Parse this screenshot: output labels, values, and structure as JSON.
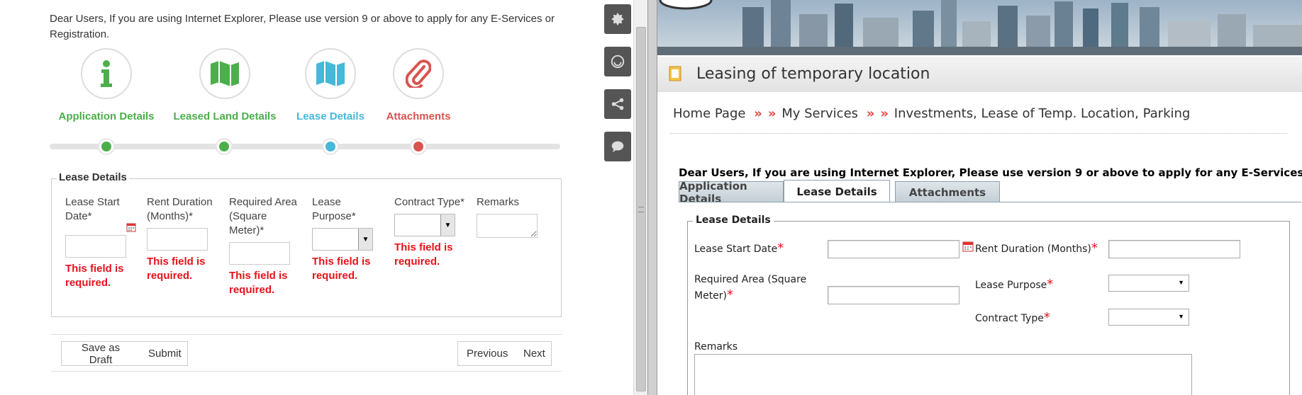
{
  "left": {
    "notice": "Dear Users, If you are using Internet Explorer, Please use version 9 or above to apply for any E-Services or Registration.",
    "steps": [
      {
        "label": "Application Details",
        "color": "#4cae4c",
        "icon": "info-icon"
      },
      {
        "label": "Leased Land Details",
        "color": "#4cae4c",
        "icon": "map-icon"
      },
      {
        "label": "Lease Details",
        "color": "#46b8da",
        "icon": "map-icon"
      },
      {
        "label": "Attachments",
        "color": "#d9534f",
        "icon": "paperclip-icon"
      }
    ],
    "legend": "Lease Details",
    "fields": {
      "lease_start": {
        "label": "Lease Start Date*",
        "value": ""
      },
      "rent_duration": {
        "label": "Rent Duration (Months)*",
        "value": ""
      },
      "required_area": {
        "label": "Required Area (Square Meter)*",
        "value": ""
      },
      "lease_purpose": {
        "label": "Lease Purpose*",
        "value": ""
      },
      "contract_type": {
        "label": "Contract Type*",
        "value": ""
      },
      "remarks": {
        "label": "Remarks",
        "value": ""
      }
    },
    "error": "This field is required.",
    "buttons": {
      "save_draft": "Save as Draft",
      "submit": "Submit",
      "previous": "Previous",
      "next": "Next"
    }
  },
  "toolbar": {
    "icons": [
      "gear-icon",
      "smiley-icon",
      "share-icon",
      "chat-icon"
    ]
  },
  "right": {
    "title": "Leasing of temporary location",
    "breadcrumb": [
      "Home Page",
      "My Services",
      "Investments, Lease of Temp. Location, Parking"
    ],
    "breadcrumb_sep": "»",
    "notice": "Dear Users, If you are using Internet Explorer, Please use version 9 or above to apply for any E-Services or Registration.",
    "tabs": [
      {
        "label": "Application Details",
        "active": false
      },
      {
        "label": "Lease Details",
        "active": true
      },
      {
        "label": "Attachments",
        "active": false
      }
    ],
    "legend": "Lease Details",
    "fields": {
      "lease_start": "Lease Start Date",
      "rent_duration": "Rent Duration (Months)",
      "required_area": "Required Area (Square Meter)",
      "lease_purpose": "Lease Purpose",
      "contract_type": "Contract Type",
      "remarks": "Remarks"
    },
    "required_mark": "*",
    "colors": {
      "required": "#e8121b",
      "breadcrumb_sep": "#e0443d"
    }
  }
}
